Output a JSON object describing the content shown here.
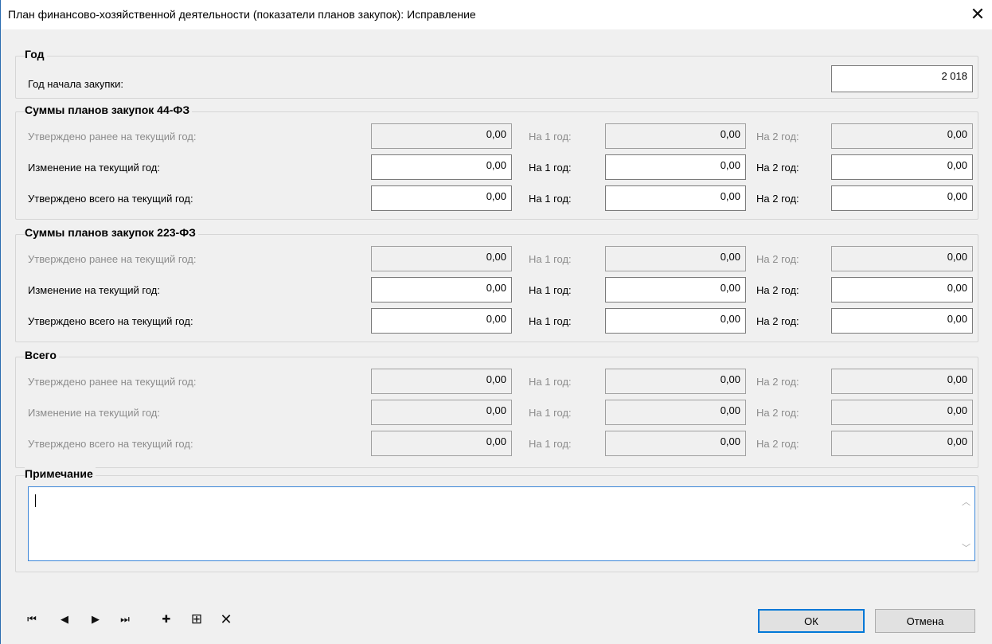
{
  "window": {
    "title": "План финансово-хозяйственной деятельности (показатели планов закупок): Исправление",
    "close_glyph": "✕"
  },
  "year_group": {
    "legend": "Год",
    "label": "Год начала закупки:",
    "value": "2 018"
  },
  "col_labels": {
    "y1": "На 1 год:",
    "y2": "На 2 год:"
  },
  "row_labels": {
    "approved_before": "Утверждено ранее на текущий год:",
    "change": "Изменение на текущий год:",
    "approved_total": "Утверждено всего на текущий год:"
  },
  "groups": [
    {
      "legend": "Суммы планов закупок 44-ФЗ",
      "rows": [
        {
          "enabled": false,
          "values": [
            "0,00",
            "0,00",
            "0,00"
          ]
        },
        {
          "enabled": true,
          "values": [
            "0,00",
            "0,00",
            "0,00"
          ]
        },
        {
          "enabled": true,
          "values": [
            "0,00",
            "0,00",
            "0,00"
          ]
        }
      ]
    },
    {
      "legend": "Суммы планов закупок 223-ФЗ",
      "rows": [
        {
          "enabled": false,
          "values": [
            "0,00",
            "0,00",
            "0,00"
          ]
        },
        {
          "enabled": true,
          "values": [
            "0,00",
            "0,00",
            "0,00"
          ]
        },
        {
          "enabled": true,
          "values": [
            "0,00",
            "0,00",
            "0,00"
          ]
        }
      ]
    },
    {
      "legend": "Всего",
      "rows": [
        {
          "enabled": false,
          "values": [
            "0,00",
            "0,00",
            "0,00"
          ]
        },
        {
          "enabled": false,
          "values": [
            "0,00",
            "0,00",
            "0,00"
          ]
        },
        {
          "enabled": false,
          "values": [
            "0,00",
            "0,00",
            "0,00"
          ]
        }
      ]
    }
  ],
  "note_group": {
    "legend": "Примечание",
    "value": ""
  },
  "nav_icons": [
    {
      "name": "first-record-icon",
      "glyph": "⏮"
    },
    {
      "name": "prev-record-icon",
      "glyph": "◀"
    },
    {
      "name": "next-record-icon",
      "glyph": "▶"
    },
    {
      "name": "last-record-icon",
      "glyph": "⏭"
    },
    {
      "name": "add-record-icon",
      "glyph": "✚"
    },
    {
      "name": "add-boxed-icon",
      "glyph": "⊞"
    },
    {
      "name": "delete-record-icon",
      "glyph": "✕"
    }
  ],
  "buttons": {
    "ok": "ОК",
    "cancel": "Отмена"
  },
  "colors": {
    "focus_border": "#3c86d8",
    "primary_button_border": "#0078d7"
  }
}
